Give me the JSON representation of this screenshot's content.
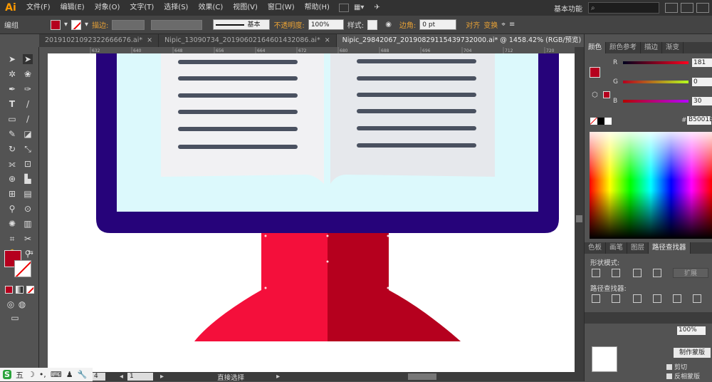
{
  "app": {
    "logo": "Ai"
  },
  "menu": [
    "文件(F)",
    "编辑(E)",
    "对象(O)",
    "文字(T)",
    "选择(S)",
    "效果(C)",
    "视图(V)",
    "窗口(W)",
    "帮助(H)"
  ],
  "workspace": "基本功能",
  "control": {
    "group_label": "编组",
    "stroke_label": "描边:",
    "stroke_profile": "基本",
    "opacity_label": "不透明度:",
    "opacity_value": "100%",
    "style_label": "样式:",
    "corner_label": "边角:",
    "corner_value": "0 pt",
    "align_label": "对齐",
    "transform_label": "变换"
  },
  "tabs": [
    {
      "title": "20191021092322666676.ai*",
      "close": "×"
    },
    {
      "title": "Nipic_13090734_20190602164601432086.ai*",
      "close": "×"
    },
    {
      "title": "Nipic_29842067_20190829115439732000.ai* @ 1458.42% (RGB/预览)",
      "close": "×"
    }
  ],
  "ruler_ticks": [
    "632",
    "640",
    "648",
    "656",
    "664",
    "672",
    "680",
    "688",
    "696",
    "704",
    "712",
    "720"
  ],
  "colors": {
    "monitor_frame": "#26037a",
    "screen": "#dcf9fc",
    "page_left": "#f1f1f3",
    "page_right": "#e6e8ec",
    "text_line": "#4a5160",
    "stand_light": "#f40f3b",
    "stand_dark": "#b5001e",
    "fill_swatch": "#b5001e"
  },
  "panel": {
    "tabs_top": [
      "颜色",
      "颜色参考",
      "描边",
      "渐变"
    ],
    "sliders": [
      {
        "label": "R",
        "value": "181"
      },
      {
        "label": "G",
        "value": "0"
      },
      {
        "label": "B",
        "value": "30"
      }
    ],
    "hex_prefix": "#",
    "hex_value": "B5001E",
    "tabs_mid": [
      "色板",
      "画笔",
      "图层",
      "路径查找器"
    ],
    "shape_modes": "形状模式:",
    "expand": "扩展",
    "pathfinder": "路径查找器:",
    "transparency_value": "100%",
    "make_mask": "制作蒙版",
    "clip": "剪切",
    "invert_mask": "反相蒙版"
  },
  "status": {
    "zoom": "4",
    "page": "1",
    "tool": "直接选择"
  },
  "taskbar": {
    "ime": "五"
  }
}
